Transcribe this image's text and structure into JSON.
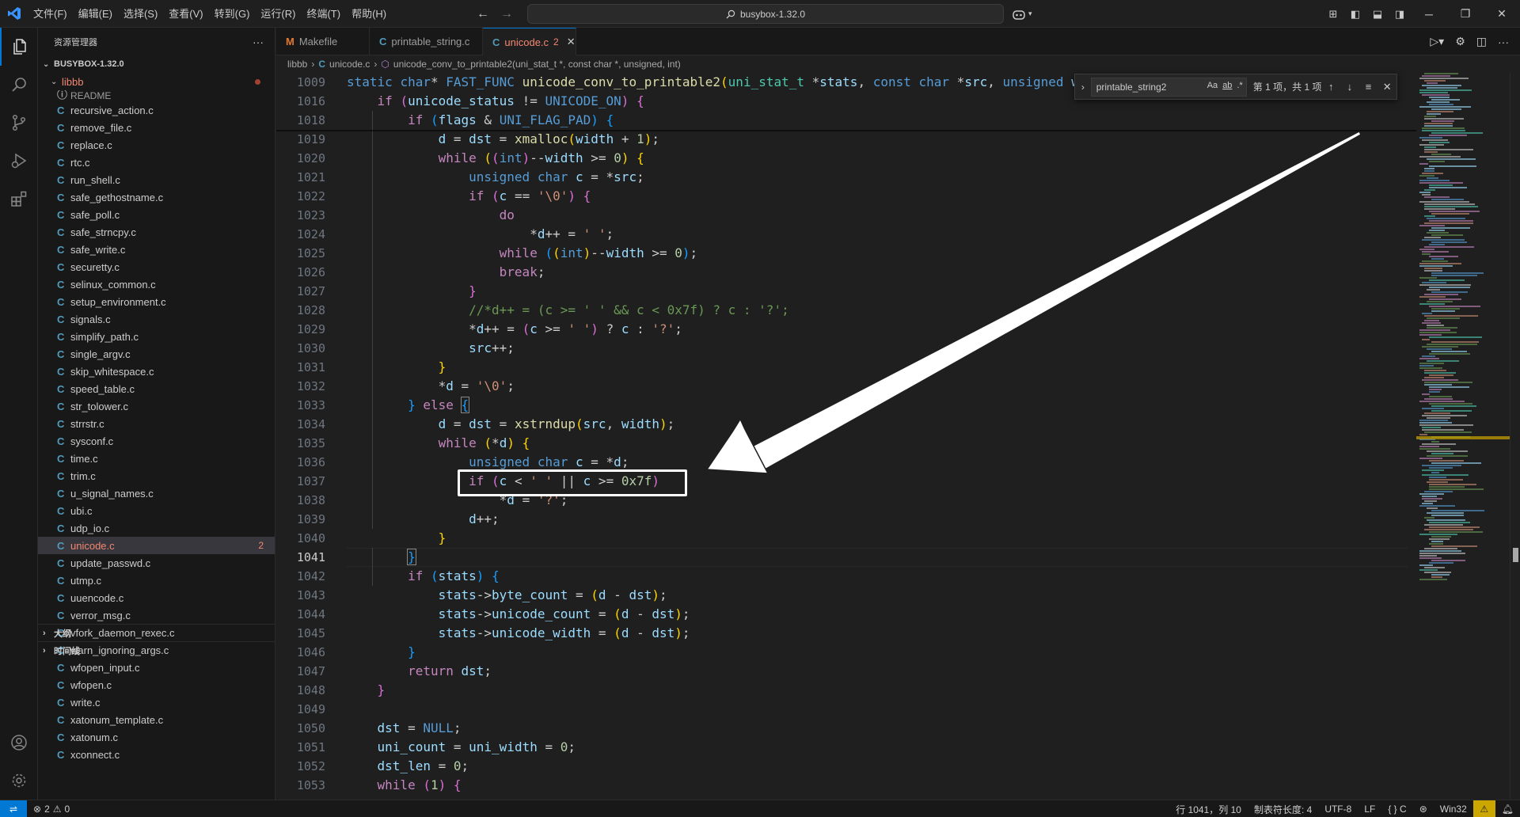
{
  "titlebar": {
    "menus": [
      "文件(F)",
      "编辑(E)",
      "选择(S)",
      "查看(V)",
      "转到(G)",
      "运行(R)",
      "终端(T)",
      "帮助(H)"
    ],
    "search_text": "busybox-1.32.0"
  },
  "sidebar": {
    "title": "资源管理器",
    "root": "BUSYBOX-1.32.0",
    "folder": "libbb",
    "partial_item": "README",
    "files": [
      "recursive_action.c",
      "remove_file.c",
      "replace.c",
      "rtc.c",
      "run_shell.c",
      "safe_gethostname.c",
      "safe_poll.c",
      "safe_strncpy.c",
      "safe_write.c",
      "securetty.c",
      "selinux_common.c",
      "setup_environment.c",
      "signals.c",
      "simplify_path.c",
      "single_argv.c",
      "skip_whitespace.c",
      "speed_table.c",
      "str_tolower.c",
      "strrstr.c",
      "sysconf.c",
      "time.c",
      "trim.c",
      "u_signal_names.c",
      "ubi.c",
      "udp_io.c",
      "unicode.c",
      "update_passwd.c",
      "utmp.c",
      "uuencode.c",
      "verror_msg.c",
      "vfork_daemon_rexec.c",
      "warn_ignoring_args.c",
      "wfopen_input.c",
      "wfopen.c",
      "write.c",
      "xatonum_template.c",
      "xatonum.c",
      "xconnect.c"
    ],
    "active_file_problems": "2",
    "outline_label": "大纲",
    "timeline_label": "时间线"
  },
  "tabs": [
    {
      "label": "Makefile",
      "icon": "M"
    },
    {
      "label": "printable_string.c",
      "icon": "C"
    },
    {
      "label": "unicode.c",
      "icon": "C",
      "badge": "2",
      "active": true
    }
  ],
  "breadcrumb": {
    "folder": "libbb",
    "file": "unicode.c",
    "symbol": "unicode_conv_to_printable2(uni_stat_t *, const char *, unsigned, int)"
  },
  "editor": {
    "line_numbers": [
      "1009",
      "1016",
      "1018",
      "1019",
      "1020",
      "1021",
      "1022",
      "1023",
      "1024",
      "1025",
      "1026",
      "1027",
      "1028",
      "1029",
      "1030",
      "1031",
      "1032",
      "1033",
      "1034",
      "1035",
      "1036",
      "1037",
      "1038",
      "1039",
      "1040",
      "1041",
      "1042",
      "1043",
      "1044",
      "1045",
      "1046",
      "1047",
      "1048",
      "1049",
      "1050",
      "1051",
      "1052",
      "1053"
    ],
    "current_line": "1041"
  },
  "find": {
    "query": "printable_string2",
    "opt_case": "Aa",
    "opt_word": "ab",
    "opt_regex": ".*",
    "result": "第 1 项，共 1 项"
  },
  "statusbar": {
    "problems_errors": "2",
    "problems_warnings": "0",
    "position": "行 1041，列 10",
    "indent": "制表符长度: 4",
    "encoding": "UTF-8",
    "eol": "LF",
    "language": "{ } C",
    "platform": "Win32"
  },
  "colors": {
    "accent": "#0078d4",
    "modified": "#f48771",
    "c_icon": "#519aba",
    "makefile_icon": "#e37933"
  }
}
